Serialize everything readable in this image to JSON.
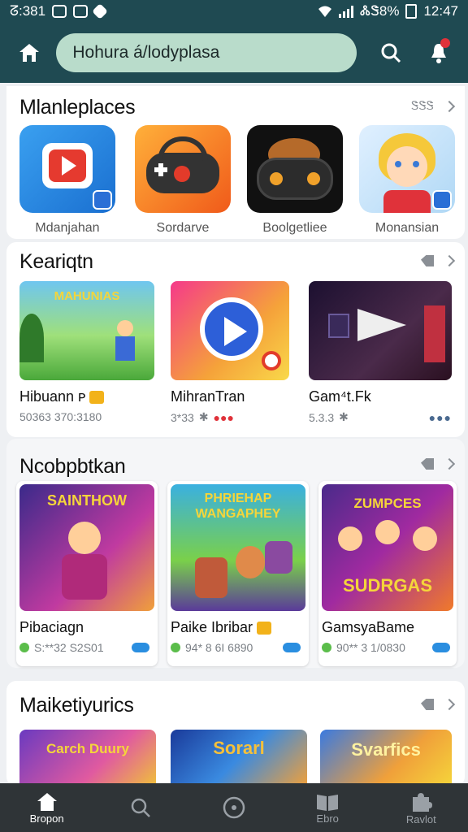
{
  "status_bar": {
    "left_text": "ᘔ:381",
    "battery_text": "ᏜᏕ8%",
    "time": "12:47"
  },
  "search": {
    "text": "Hohura á/lodyplasa"
  },
  "sections": {
    "marketplaces": {
      "title": "Mlanleplaces",
      "more_label": "ᏕᏕᏕ",
      "apps": [
        {
          "name": "Mdanjahan",
          "icon": "video-play-icon"
        },
        {
          "name": "Sordarve",
          "icon": "gamepad-icon"
        },
        {
          "name": "Boolgetliee",
          "icon": "controller-icon"
        },
        {
          "name": "Monansian",
          "icon": "cartoon-girl-icon"
        }
      ]
    },
    "keariqtn": {
      "title": "Keariqtn",
      "items": [
        {
          "title": "Hibuann ᴘ",
          "sub": "50363 370:3180",
          "thumb_text": "MAHUNIAS"
        },
        {
          "title": "MihranTran",
          "sub": "3*33",
          "thumb_text": ""
        },
        {
          "title": "Gam⁴t.Fk",
          "sub": "5.3.3",
          "thumb_text": ""
        }
      ]
    },
    "nocobtkan": {
      "title": "Ncobpbtkan",
      "items": [
        {
          "title": "Pibaciagn",
          "sub": "S:**32 S2S01",
          "thumb_text": "SAINTHOW"
        },
        {
          "title": "Paike Ibribar",
          "sub": "94* 8 6I 6890",
          "thumb_text": "PHRIEHAP WANGAPHEY"
        },
        {
          "title": "GamsyaBame",
          "sub": "90** 3 1/0830",
          "thumb_text": "SUDRGAS"
        }
      ]
    },
    "maiketiyurics": {
      "title": "Maiketiyurics",
      "items": [
        {
          "thumb_text": "Carch Duury"
        },
        {
          "thumb_text": "Sorarl"
        },
        {
          "thumb_text": "Svarfics"
        }
      ]
    }
  },
  "bottom_nav": [
    {
      "label": "Bropon",
      "icon": "home-icon"
    },
    {
      "label": "",
      "icon": "search-icon"
    },
    {
      "label": "",
      "icon": "compass-icon"
    },
    {
      "label": "Ebro",
      "icon": "book-icon"
    },
    {
      "label": "Ravlot",
      "icon": "puzzle-icon"
    }
  ]
}
